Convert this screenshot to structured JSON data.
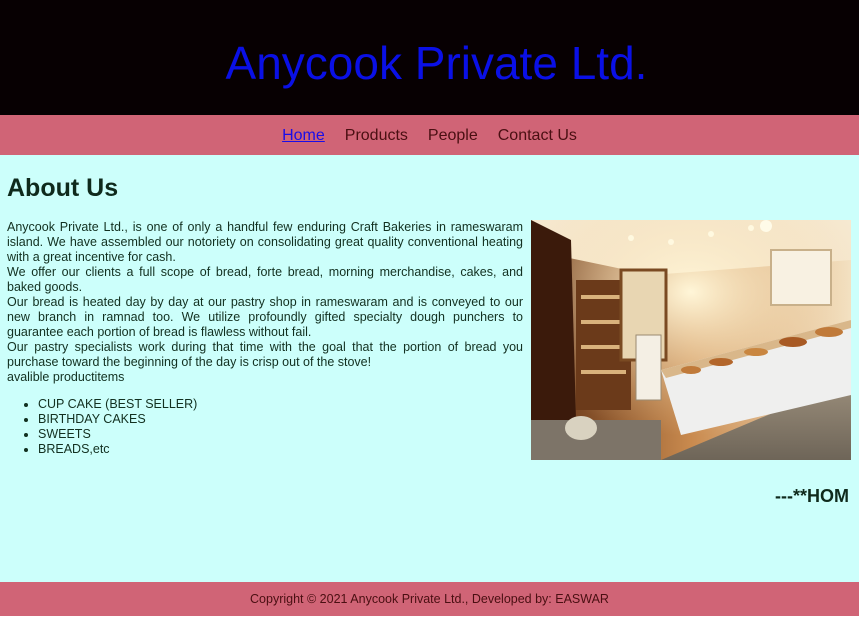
{
  "header": {
    "title": "Anycook Private Ltd."
  },
  "nav": {
    "items": [
      {
        "label": "Home",
        "active": true
      },
      {
        "label": "Products",
        "active": false
      },
      {
        "label": "People",
        "active": false
      },
      {
        "label": "Contact Us",
        "active": false
      }
    ]
  },
  "main": {
    "heading": "About Us",
    "paragraphs": [
      "Anycook Private Ltd., is one of only a handful few enduring Craft Bakeries in rameswaram island. We have assembled our notoriety on consolidating great quality conventional heating with a great incentive for cash.",
      "We offer our clients a full scope of bread, forte bread, morning merchandise, cakes, and baked goods.",
      "Our bread is heated day by day at our pastry shop in rameswaram and is conveyed to our new branch in ramnad too. We utilize profoundly gifted specialty dough punchers to guarantee each portion of bread is flawless without fail.",
      "Our pastry specialists work during that time with the goal that the portion of bread you purchase toward the beginning of the day is crisp out of the stove!",
      "avalible productitems"
    ],
    "products": [
      "CUP CAKE (BEST SELLER)",
      "BIRTHDAY CAKES",
      "SWEETS",
      "BREADS,etc"
    ],
    "home_mark": "---**HOM"
  },
  "footer": {
    "text": "Copyright © 2021 Anycook Private Ltd., Developed by: EASWAR"
  },
  "colors": {
    "header_bg": "#070002",
    "title": "#0a10e6",
    "nav_bg": "#d06476",
    "page_bg": "#ccfffb",
    "text": "#123020"
  }
}
